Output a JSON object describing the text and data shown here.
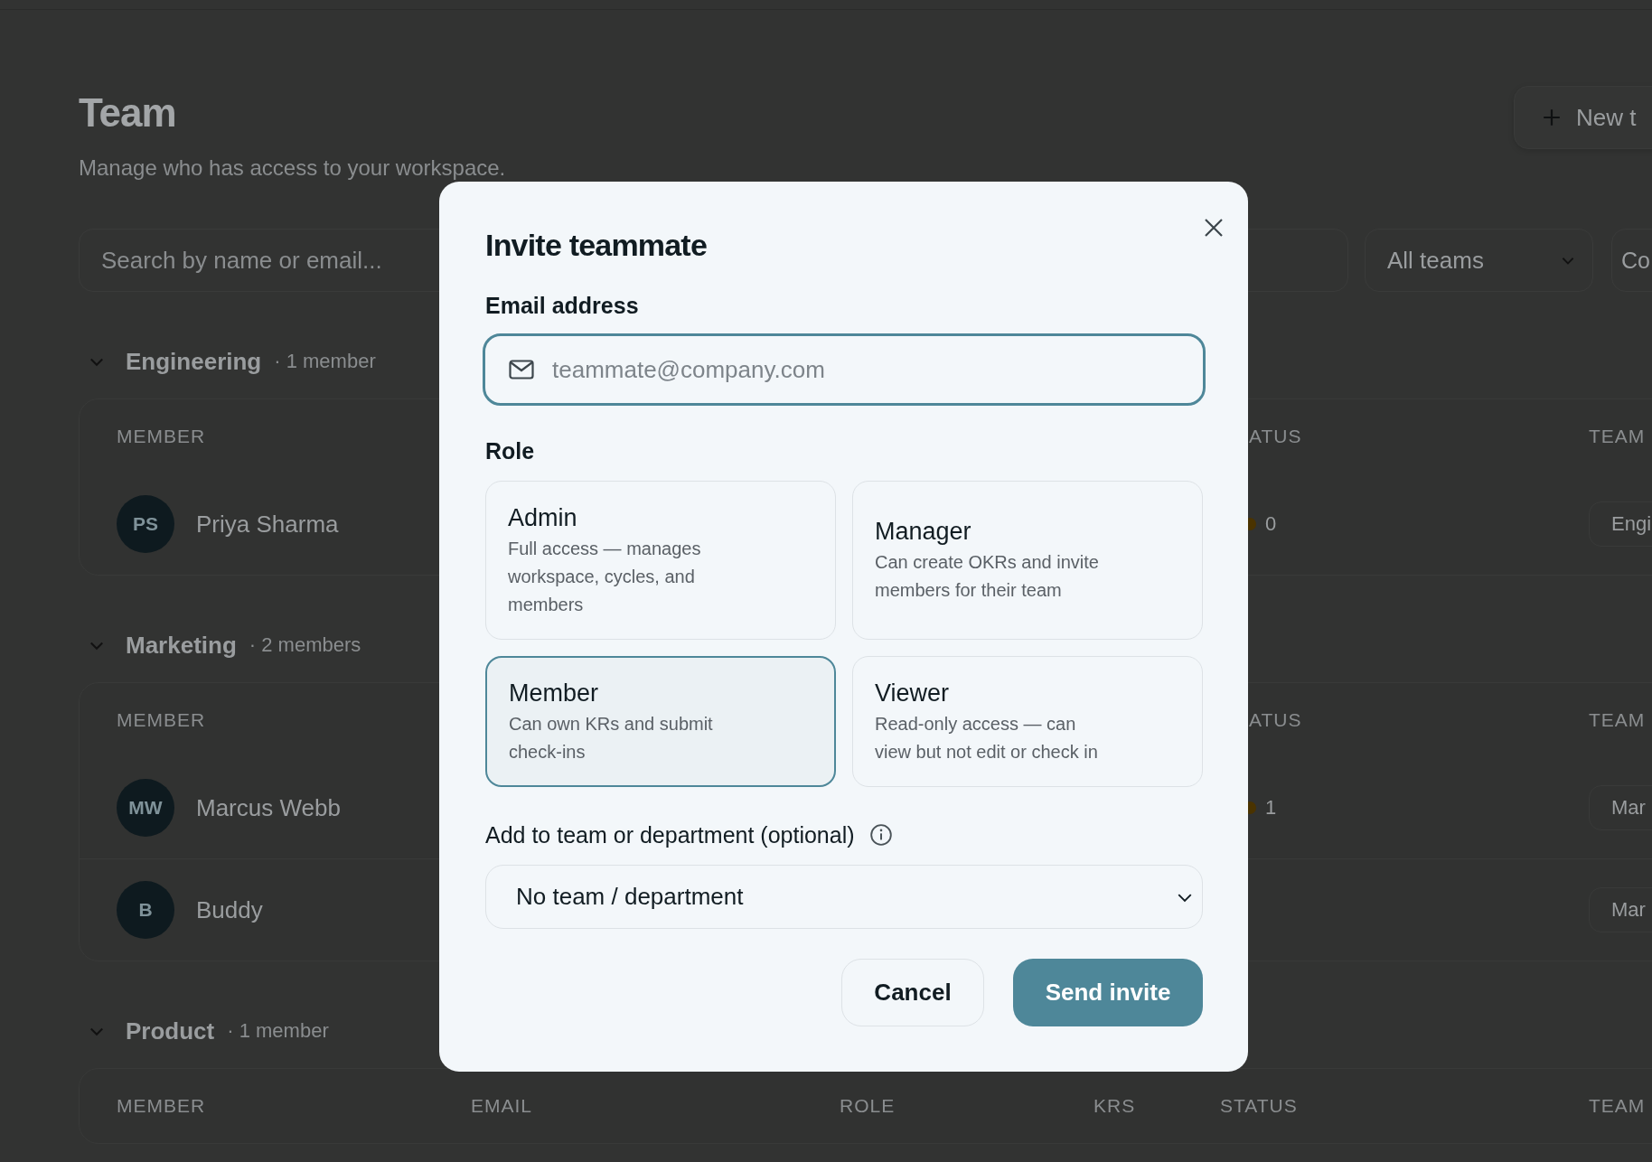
{
  "page": {
    "title": "Team",
    "subtitle": "Manage who has access to your workspace.",
    "new_button": "New t"
  },
  "filters": {
    "search_placeholder": "Search by name or email...",
    "team_filter": "All teams",
    "filter_3": "Co"
  },
  "groups": [
    {
      "name": "Engineering",
      "count": "· 1 member",
      "expanded": true,
      "columns": [
        {
          "kind": "member",
          "label": "MEMBER"
        },
        {
          "kind": "status",
          "label": "ATUS"
        },
        {
          "kind": "team",
          "label": "TEAM"
        }
      ],
      "rows": [
        {
          "initials": "PS",
          "name": "Priya Sharma",
          "status": "0",
          "team": "Engi"
        }
      ]
    },
    {
      "name": "Marketing",
      "count": "· 2 members",
      "expanded": true,
      "columns": [
        {
          "kind": "member",
          "label": "MEMBER"
        },
        {
          "kind": "status",
          "label": "ATUS"
        },
        {
          "kind": "team",
          "label": "TEAM"
        }
      ],
      "rows": [
        {
          "initials": "MW",
          "name": "Marcus Webb",
          "status": "1",
          "team": "Mar"
        },
        {
          "initials": "B",
          "name": "Buddy",
          "team": "Mar"
        }
      ]
    },
    {
      "name": "Product",
      "count": "· 1 member",
      "expanded": true,
      "columns": [
        {
          "kind": "member",
          "label": "MEMBER"
        },
        {
          "kind": "email",
          "label": "EMAIL"
        },
        {
          "kind": "role",
          "label": "ROLE"
        },
        {
          "kind": "krs",
          "label": "KRS"
        },
        {
          "kind": "status",
          "label": "STATUS"
        },
        {
          "kind": "team",
          "label": "TEAM"
        }
      ]
    }
  ],
  "dialog": {
    "title": "Invite teammate",
    "email_label": "Email address",
    "email_placeholder": "teammate@company.com",
    "role_label": "Role",
    "roles": [
      {
        "title": "Admin",
        "description": "Full access — manages workspace, cycles, and members",
        "selected": false
      },
      {
        "title": "Manager",
        "description": "Can create OKRs and invite members for their team",
        "selected": false
      },
      {
        "title": "Member",
        "description": "Can own KRs and submit check-ins",
        "selected": true
      },
      {
        "title": "Viewer",
        "description": "Read-only access — can view but not edit or check in",
        "selected": false
      }
    ],
    "team_label": "Add to team or department (optional)",
    "team_value": "No team / department",
    "buttons": {
      "cancel": "Cancel",
      "submit": "Send invite"
    }
  }
}
